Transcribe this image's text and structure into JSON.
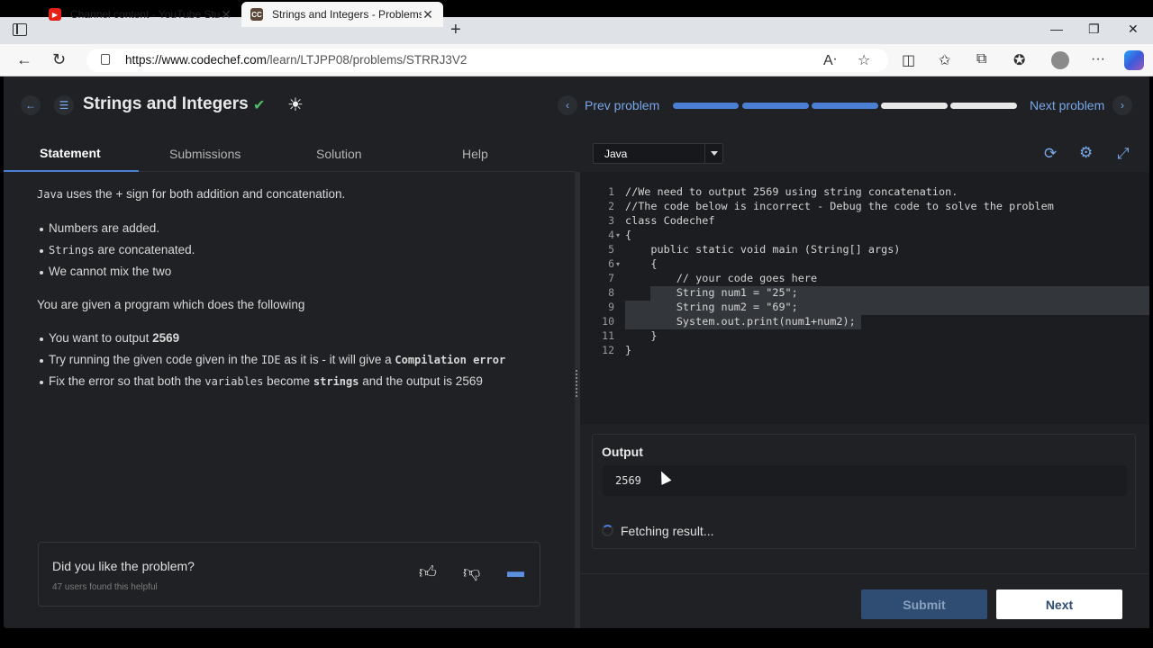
{
  "browser": {
    "tabs": [
      {
        "title": "Channel content - YouTube Studio",
        "favicon": "youtube-icon"
      },
      {
        "title": "Strings and Integers - Problems",
        "favicon": "codechef-icon"
      }
    ],
    "url_host": "https://www.codechef.com",
    "url_path": "/learn/LTJPP08/problems/STRRJ3V2"
  },
  "header": {
    "title": "Strings and Integers",
    "prev_label": "Prev problem",
    "next_label": "Next problem",
    "progress": [
      1,
      1,
      1,
      0,
      0
    ]
  },
  "left_tabs": [
    "Statement",
    "Submissions",
    "Solution",
    "Help"
  ],
  "statement": {
    "intro_code": "Java",
    "intro_text": " uses the + sign for both addition and concatenation.",
    "bullets1": [
      {
        "pre": "",
        "code": "",
        "text": "Numbers are added."
      },
      {
        "pre": "",
        "code": "Strings",
        "text": " are concatenated."
      },
      {
        "pre": "",
        "code": "",
        "text": "We cannot mix the two"
      }
    ],
    "given": "You are given a program which does the following",
    "b2_1_text": "You want to output ",
    "b2_1_bold": "2569",
    "b2_2_a": "Try running the given code given in the ",
    "b2_2_code1": "IDE",
    "b2_2_b": " as it is - it will give a ",
    "b2_2_code2": "Compilation error",
    "b2_3_a": "Fix the error so that both the ",
    "b2_3_code1": "variables",
    "b2_3_b": " become ",
    "b2_3_code2": "strings",
    "b2_3_c": " and the output is 2569"
  },
  "feedback": {
    "question": "Did you like the problem?",
    "count": "47 users found this helpful"
  },
  "editor": {
    "language": "Java",
    "lines": [
      "//We need to output 2569 using string concatenation.",
      "//The code below is incorrect - Debug the code to solve the problem",
      "class Codechef",
      "{",
      "    public static void main (String[] args)",
      "    {",
      "        // your code goes here",
      "        String num1 = \"25\";",
      "        String num2 = \"69\";",
      "        System.out.print(num1+num2);",
      "    }",
      "}"
    ]
  },
  "output": {
    "label": "Output",
    "value": "2569",
    "status": "Fetching result..."
  },
  "buttons": {
    "submit": "Submit",
    "next": "Next"
  },
  "colors": {
    "accent": "#4a7fd4",
    "link": "#7aa7e8",
    "success": "#4cbf6b",
    "panel": "#1f2124"
  }
}
